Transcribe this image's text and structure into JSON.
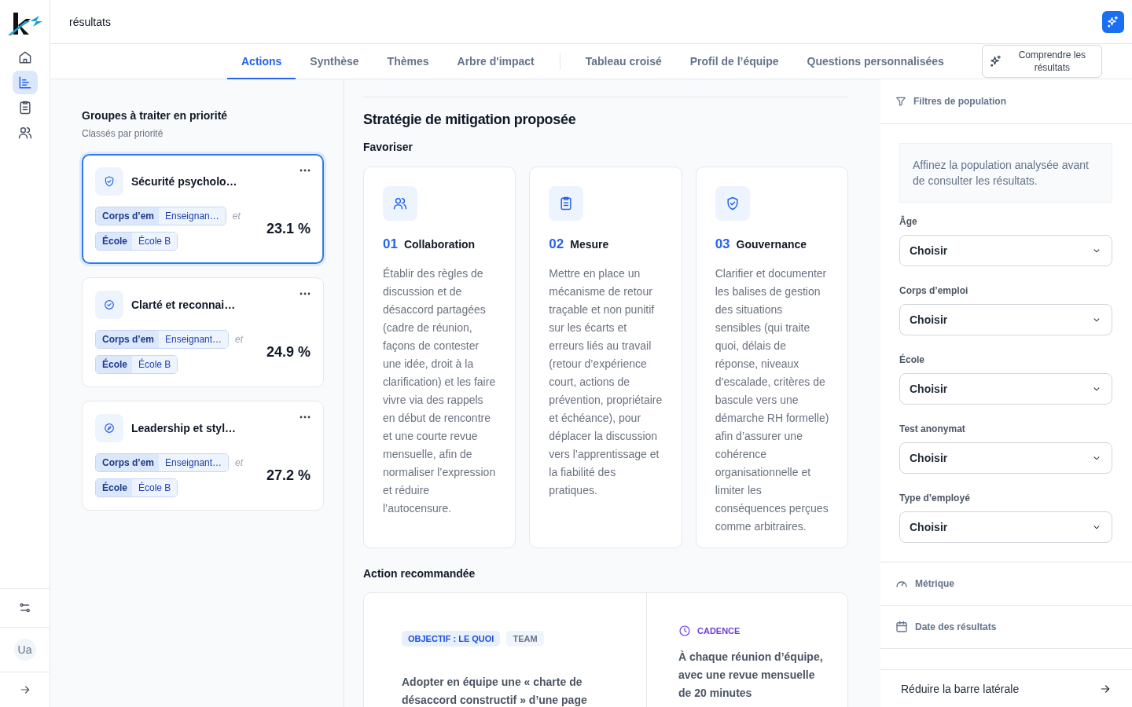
{
  "header": {
    "title": "résultats"
  },
  "nav": [
    {
      "selected": false
    },
    {
      "selected": true
    },
    {
      "selected": false
    },
    {
      "selected": false
    }
  ],
  "user": {
    "initials": "Ua"
  },
  "tabs": [
    {
      "label": "Actions",
      "selected": true
    },
    {
      "label": "Synthèse",
      "selected": false
    },
    {
      "label": "Thèmes",
      "selected": false
    },
    {
      "label": "Arbre d'impact",
      "selected": false
    },
    {
      "label": "Tableau croisé",
      "selected": false
    },
    {
      "label": "Profil de l’équipe",
      "selected": false
    },
    {
      "label": "Questions personnalisées",
      "selected": false
    }
  ],
  "explain_button": "Comprendre les résultats",
  "groups": {
    "title": "Groupes à traiter en priorité",
    "subtitle": "Classés par priorité",
    "items": [
      {
        "title": "Sécurité psycholo…",
        "selected": true,
        "filters": [
          {
            "key": "Corps d’em",
            "value": "Enseignan…"
          },
          {
            "key": "École",
            "value": "École B"
          }
        ],
        "joiner": "et",
        "score": "23.1 %"
      },
      {
        "title": "Clarté et reconnai…",
        "selected": false,
        "filters": [
          {
            "key": "Corps d’em",
            "value": "Enseignant…"
          },
          {
            "key": "École",
            "value": "École B"
          }
        ],
        "joiner": "et",
        "score": "24.9 %"
      },
      {
        "title": "Leadership et styl…",
        "selected": false,
        "filters": [
          {
            "key": "Corps d’em",
            "value": "Enseignant…"
          },
          {
            "key": "École",
            "value": "École B"
          }
        ],
        "joiner": "et",
        "score": "27.2 %"
      }
    ]
  },
  "strategy": {
    "title": "Stratégie de mitigation proposée",
    "subtitle": "Favoriser",
    "cards": [
      {
        "number": "01",
        "title": "Collaboration",
        "text": "Établir des règles de discussion et de désaccord partagées (cadre de réunion, façons de contester une idée, droit à la clarification) et les faire vivre via des rappels en début de rencontre et une courte revue mensuelle, afin de normaliser l’expression et réduire l’autocensure."
      },
      {
        "number": "02",
        "title": "Mesure",
        "text": "Mettre en place un mécanisme de retour traçable et non punitif sur les écarts et erreurs liés au travail (retour d’expérience court, actions de prévention, propriétaire et échéance), pour déplacer la discussion vers l’apprentissage et la fiabilité des pratiques."
      },
      {
        "number": "03",
        "title": "Gouvernance",
        "text": "Clarifier et documenter les balises de gestion des situations sensibles (qui traite quoi, délais de réponse, niveaux d’escalade, critères de bascule vers une démarche RH formelle) afin d’assurer une cohérence organisationnelle et limiter les conséquences perçues comme arbitraires."
      }
    ]
  },
  "recommended": {
    "title": "Action recommandée",
    "tags": [
      {
        "label": "OBJECTIF : LE QUOI",
        "kind": "primary"
      },
      {
        "label": "TEAM",
        "kind": "neutral"
      }
    ],
    "action": "Adopter en équipe une « charte de désaccord constructif » d’une page",
    "cadence_label": "CADENCE",
    "cadence": "À chaque réunion d’équipe, avec une revue mensuelle de 20 minutes"
  },
  "filters_panel": {
    "title": "Filtres de population",
    "hint": "Affinez la population analysée avant de consulter les résultats.",
    "filters": [
      {
        "label": "Âge",
        "value": "Choisir"
      },
      {
        "label": "Corps d’emploi",
        "value": "Choisir"
      },
      {
        "label": "École",
        "value": "Choisir"
      },
      {
        "label": "Test anonymat",
        "value": "Choisir"
      },
      {
        "label": "Type d’employé",
        "value": "Choisir"
      }
    ],
    "sections": [
      {
        "label": "Métrique"
      },
      {
        "label": "Date des résultats"
      }
    ],
    "collapse": "Réduire la barre latérale"
  }
}
